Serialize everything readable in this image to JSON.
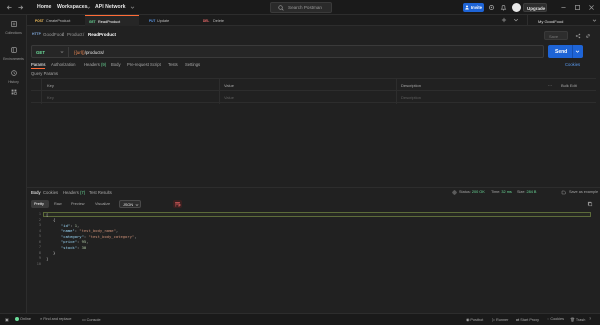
{
  "topbar": {
    "home": "Home",
    "workspaces": "Workspaces",
    "api_network": "API Network",
    "search_placeholder": "Search Postman",
    "invite": "Invite",
    "upgrade": "Upgrade"
  },
  "sidebar": {
    "items": [
      {
        "label": "Collections",
        "icon": "collections-icon"
      },
      {
        "label": "Environments",
        "icon": "environments-icon"
      },
      {
        "label": "History",
        "icon": "history-icon"
      },
      {
        "label": "",
        "icon": "more-apps-icon"
      }
    ]
  },
  "tabs": [
    {
      "method": "POST",
      "label": "CreateProduct",
      "method_color": "#f5c05b"
    },
    {
      "method": "GET",
      "label": "ReadProduct",
      "method_color": "#6bdd9a",
      "active": true
    },
    {
      "method": "PUT",
      "label": "Update",
      "method_color": "#5b9bef"
    },
    {
      "method": "DEL",
      "label": "Delete",
      "method_color": "#ef6b6b"
    }
  ],
  "environment": "My GoodFood",
  "breadcrumb": {
    "http": "HTTP",
    "collection": "GoodFood",
    "folder": "Product",
    "request": "ReadProduct",
    "save": "Save"
  },
  "request": {
    "method": "GET",
    "url_var": "{{url}}",
    "url_path": "/products/",
    "send": "Send"
  },
  "request_tabs": [
    {
      "label": "Params",
      "active": true
    },
    {
      "label": "Authorization"
    },
    {
      "label": "Headers",
      "count": "(9)"
    },
    {
      "label": "Body"
    },
    {
      "label": "Pre-request Script"
    },
    {
      "label": "Tests"
    },
    {
      "label": "Settings"
    }
  ],
  "cookies": "Cookies",
  "query_params_title": "Query Params",
  "params_table": {
    "headers": [
      "Key",
      "Value",
      "Description",
      "Bulk Edit"
    ],
    "placeholders": [
      "Key",
      "Value",
      "Description"
    ]
  },
  "response_tabs": [
    {
      "label": "Body",
      "active": true
    },
    {
      "label": "Cookies"
    },
    {
      "label": "Headers",
      "count": "(7)"
    },
    {
      "label": "Test Results"
    }
  ],
  "response_stats": {
    "status_label": "Status:",
    "status": "200 OK",
    "time_label": "Time:",
    "time": "32 ms",
    "size_label": "Size:",
    "size": "284 B",
    "save_as_example": "Save as example"
  },
  "response_views": [
    "Pretty",
    "Raw",
    "Preview",
    "Visualize"
  ],
  "response_format": "JSON",
  "response_body": {
    "line_numbers": [
      "1",
      "2",
      "3",
      "4",
      "5",
      "6",
      "7",
      "8",
      "9",
      "10"
    ],
    "id": 1,
    "name": "test_body_name",
    "category": "test_body_category",
    "price": 95,
    "stock": 30
  },
  "statusbar": {
    "online": "Online",
    "find_replace": "Find and replace",
    "console": "Console",
    "postbot": "Postbot",
    "runner": "Runner",
    "start_proxy": "Start Proxy",
    "cookies": "Cookies",
    "trash": "Trash"
  },
  "colors": {
    "accent": "#1e64d6",
    "get_method": "#6bdd9a",
    "active_tab_border": "#ff6c37"
  }
}
